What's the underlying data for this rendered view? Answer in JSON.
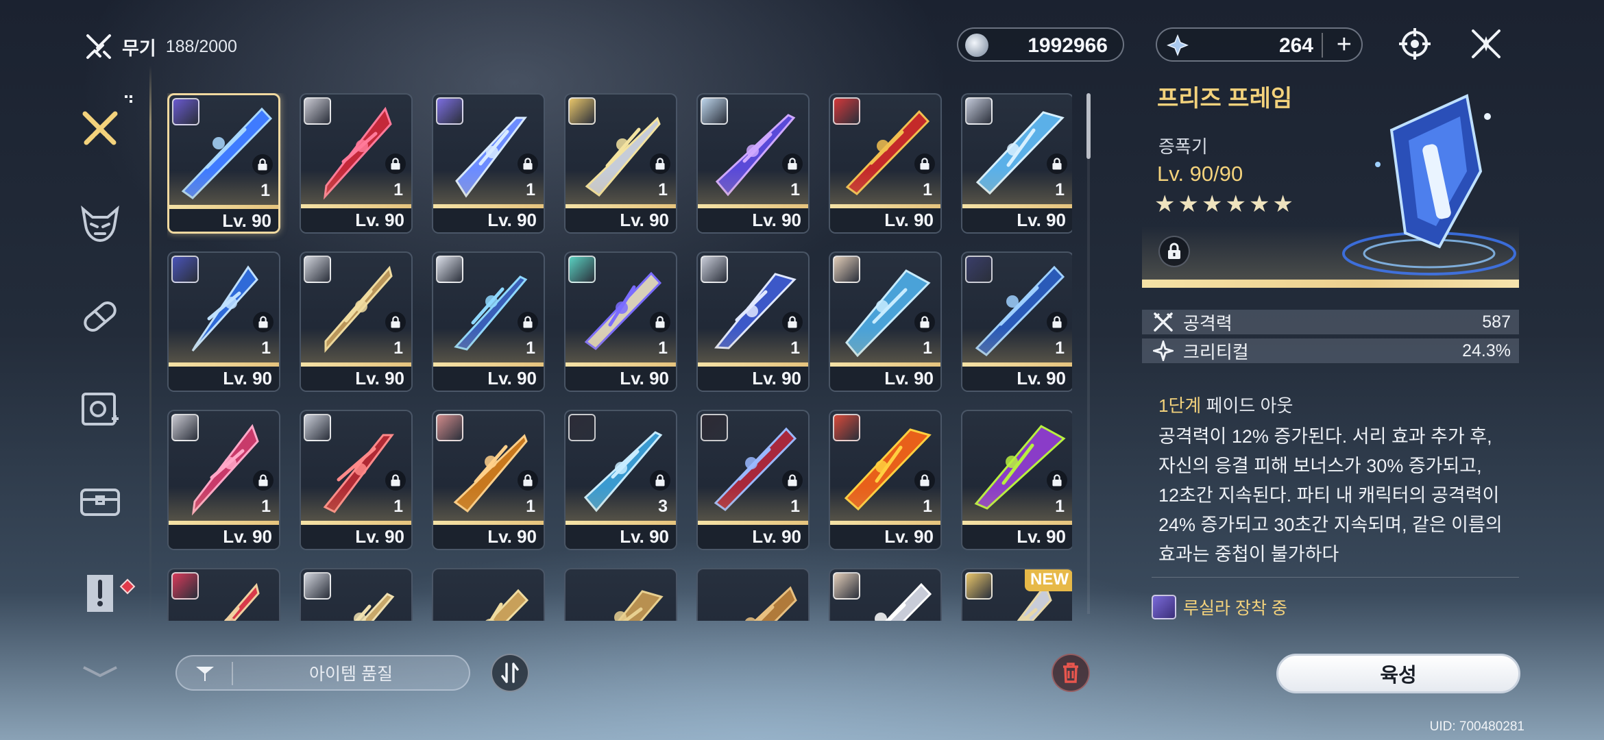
{
  "header": {
    "category": "무기",
    "count": "188/2000"
  },
  "currency": {
    "coins": "1992966",
    "crystals": "264",
    "add_label": "+"
  },
  "sidebar": {
    "items": [
      {
        "name": "weapon",
        "icon": "crossed-swords-icon",
        "active": true
      },
      {
        "name": "mask",
        "icon": "demon-mask-icon",
        "active": false
      },
      {
        "name": "consumable",
        "icon": "capsule-icon",
        "active": false
      },
      {
        "name": "module",
        "icon": "gear-module-icon",
        "active": false
      },
      {
        "name": "chest",
        "icon": "chest-icon",
        "active": false
      },
      {
        "name": "quest-item",
        "icon": "notice-icon",
        "active": false,
        "badge": true
      },
      {
        "name": "more",
        "icon": "chevron-down-icon",
        "active": false
      }
    ]
  },
  "grid": {
    "items": [
      {
        "level": "Lv. 90",
        "qty": "1",
        "selected": true,
        "color": "#3f7bff",
        "accent": "#a9d8ff",
        "avatar": "#6a5ad0"
      },
      {
        "level": "Lv. 90",
        "qty": "1",
        "color": "#c4283a",
        "accent": "#ff7a9a",
        "avatar": "#c9c9d2"
      },
      {
        "level": "Lv. 90",
        "qty": "1",
        "color": "#6c8cff",
        "accent": "#d8eaff",
        "avatar": "#7c6ee0"
      },
      {
        "level": "Lv. 90",
        "qty": "1",
        "color": "#c6ccd8",
        "accent": "#f3e3a0",
        "avatar": "#e8c56a"
      },
      {
        "level": "Lv. 90",
        "qty": "1",
        "color": "#5a4ad8",
        "accent": "#cfa8ff",
        "avatar": "#bcd4ea"
      },
      {
        "level": "Lv. 90",
        "qty": "1",
        "color": "#c42a2a",
        "accent": "#f2c050",
        "avatar": "#d4383a"
      },
      {
        "level": "Lv. 90",
        "qty": "1",
        "color": "#5bb0e8",
        "accent": "#d8f0ff",
        "avatar": "#c2c8d8"
      },
      {
        "level": "Lv. 90",
        "qty": "1",
        "color": "#2f6ad8",
        "accent": "#bfe0ff",
        "avatar": "#4a54b8"
      },
      {
        "level": "Lv. 90",
        "qty": "1",
        "color": "#b9955a",
        "accent": "#f0dca0",
        "avatar": "#cfd2da"
      },
      {
        "level": "Lv. 90",
        "qty": "1",
        "color": "#3a5fb8",
        "accent": "#8fd8ff",
        "avatar": "#d8dce6"
      },
      {
        "level": "Lv. 90",
        "qty": "1",
        "color": "#d8d0b8",
        "accent": "#7a6cff",
        "avatar": "#5ad0c0"
      },
      {
        "level": "Lv. 90",
        "qty": "1",
        "color": "#3c58c8",
        "accent": "#e0e8ff",
        "avatar": "#c8ccd8"
      },
      {
        "level": "Lv. 90",
        "qty": "1",
        "color": "#4aa2d8",
        "accent": "#c8ecff",
        "avatar": "#e2cdb8"
      },
      {
        "level": "Lv. 90",
        "qty": "1",
        "color": "#2a5ab8",
        "accent": "#9fd0ff",
        "avatar": "#3a3e6a"
      },
      {
        "level": "Lv. 90",
        "qty": "1",
        "color": "#c83a6a",
        "accent": "#ffa8c8",
        "avatar": "#c8c8d0"
      },
      {
        "level": "Lv. 90",
        "qty": "1",
        "color": "#b02a34",
        "accent": "#ff8a8a",
        "avatar": "#c8ccd6"
      },
      {
        "level": "Lv. 90",
        "qty": "1",
        "color": "#c8781e",
        "accent": "#ffd08a",
        "avatar": "#d08a8a"
      },
      {
        "level": "Lv. 90",
        "qty": "3",
        "color": "#3a9ad0",
        "accent": "#c8ecff",
        "avatar": "#2c2c38"
      },
      {
        "level": "Lv. 90",
        "qty": "1",
        "color": "#a8283c",
        "accent": "#9ab8ff",
        "avatar": "#2e2a34"
      },
      {
        "level": "Lv. 90",
        "qty": "1",
        "color": "#e8601a",
        "accent": "#ffd040",
        "avatar": "#d84a3a"
      },
      {
        "level": "Lv. 90",
        "qty": "1",
        "color": "#8a3cc8",
        "accent": "#b8f040",
        "avatar": null
      },
      {
        "level": "",
        "qty": "",
        "color": "#d83a4a",
        "accent": "#f0d0a0",
        "avatar": "#d83a5a"
      },
      {
        "level": "",
        "qty": "",
        "color": "#c8a86a",
        "accent": "#f0e0b0",
        "avatar": "#cfd2da"
      },
      {
        "level": "",
        "qty": "",
        "color": "#c8a05a",
        "accent": "#f0dca0",
        "avatar": null
      },
      {
        "level": "",
        "qty": "",
        "color": "#b89050",
        "accent": "#e8d090",
        "avatar": null
      },
      {
        "level": "",
        "qty": "",
        "color": "#b07a3a",
        "accent": "#e8c080",
        "avatar": null
      },
      {
        "level": "",
        "qty": "",
        "color": "#c8ccd8",
        "accent": "#ffffff",
        "avatar": "#e2cdb8"
      },
      {
        "level": "",
        "qty": "",
        "color": "#c8ccd8",
        "accent": "#e8d8a8",
        "avatar": "#e8c56a",
        "badge": "NEW"
      }
    ]
  },
  "bottom": {
    "filter_label": "아이템 품질",
    "grow_label": "육성",
    "uid": "UID: 700480281"
  },
  "detail": {
    "name": "프리즈 프레임",
    "type": "증폭기",
    "level": "Lv. 90/90",
    "stars": 6,
    "star_glyph": "★",
    "stats": [
      {
        "name": "공격력",
        "value": "587",
        "icon": "attack-icon"
      },
      {
        "name": "크리티컬",
        "value": "24.3%",
        "icon": "crit-icon"
      }
    ],
    "skill_stage": "1단계",
    "skill_name": "페이드 아웃",
    "description_lines": [
      "공격력이 12% 증가된다. 서리 효과 추가 후,",
      "자신의 응결 피해 보너스가 30% 증가되고,",
      "12초간 지속된다. 파티 내 캐릭터의 공격력이",
      "24% 증가되고 30초간 지속되며, 같은 이름의",
      "효과는 중첩이 불가하다"
    ],
    "equipped_by": "루실라 장착 중"
  },
  "colors": {
    "gold": "#f3d27c",
    "selected_border": "#f1d9a0",
    "badge_red": "#e23a4a"
  }
}
